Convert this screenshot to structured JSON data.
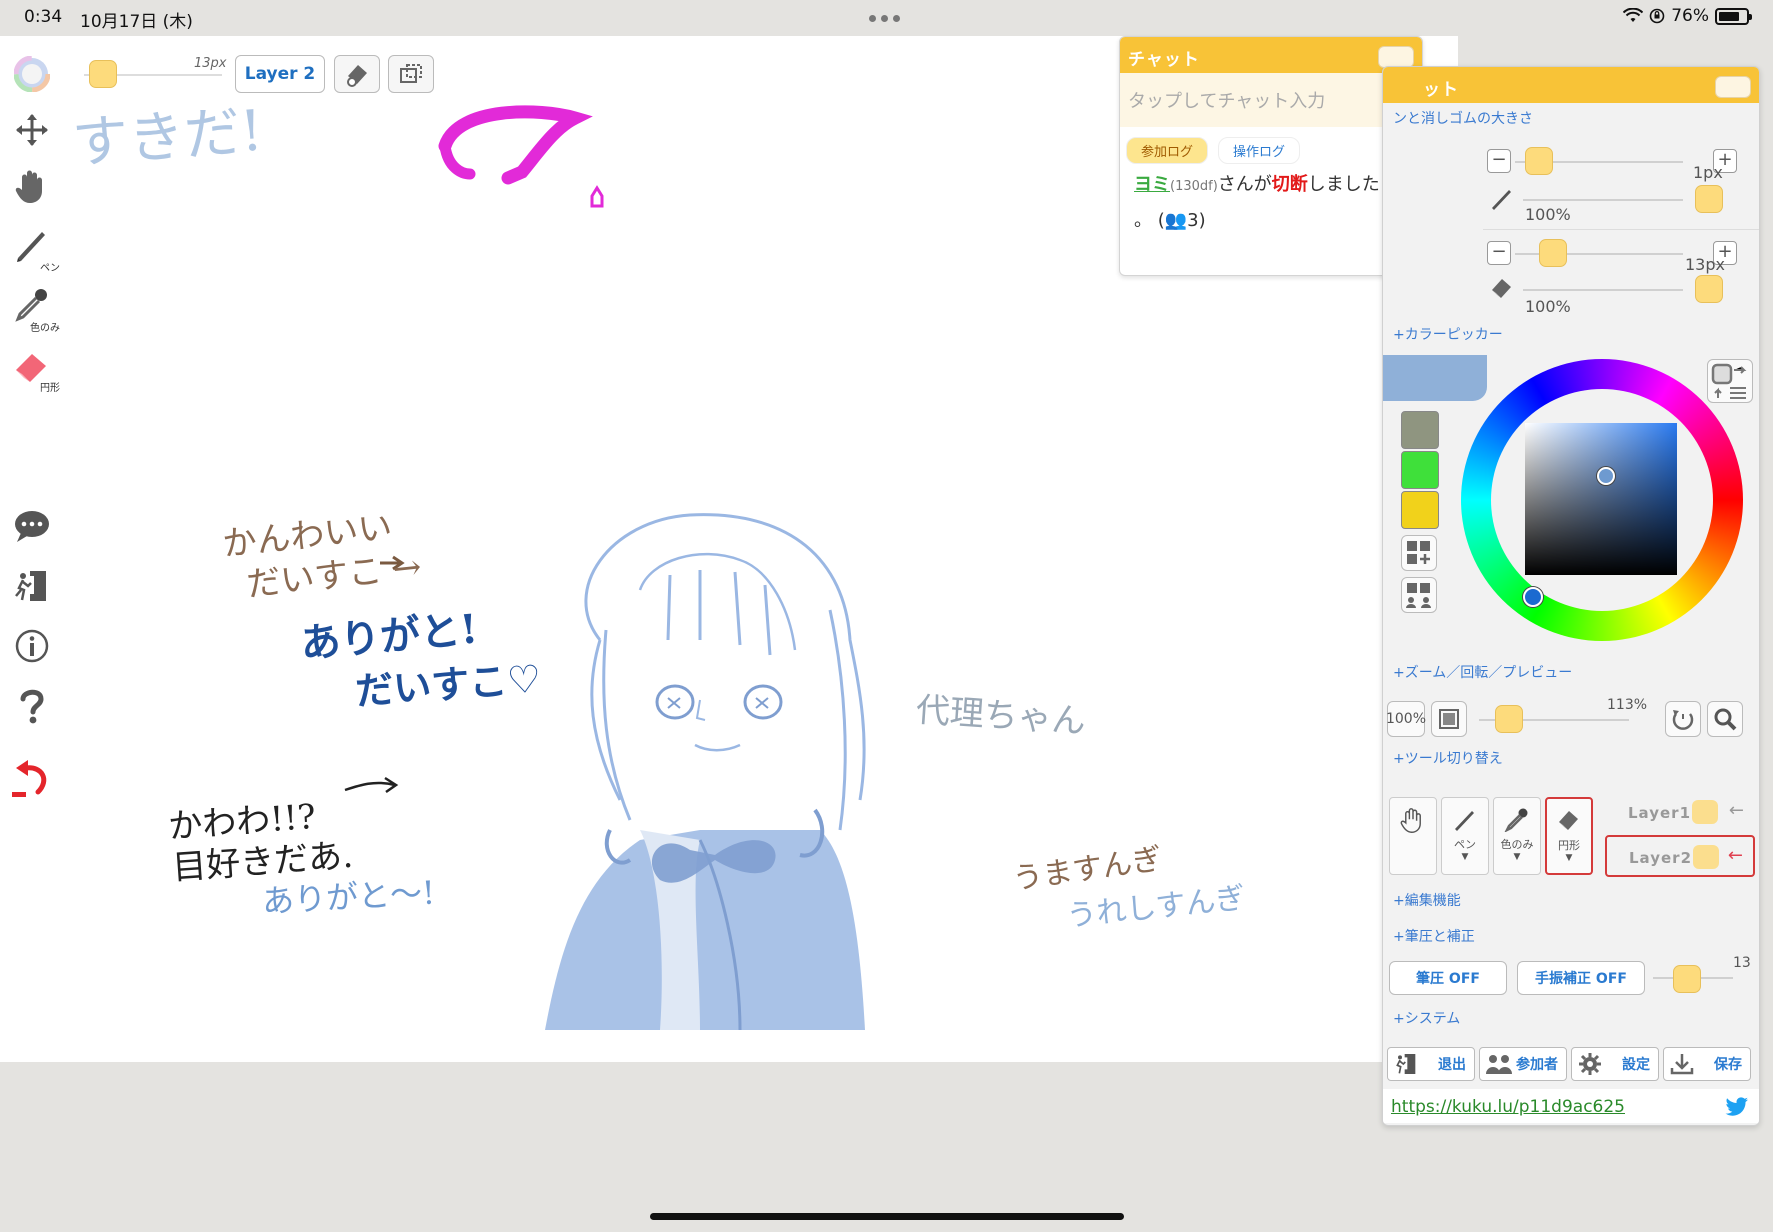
{
  "status_bar": {
    "time": "0:34",
    "date": "10月17日 (木)",
    "battery": "76%"
  },
  "canvas_toolbar": {
    "size": "13px",
    "layer": "Layer 2"
  },
  "left_toolbar": {
    "pen_label": "ペン",
    "dropper_label": "色のみ",
    "eraser_label": "円形"
  },
  "canvas_text": {
    "t1": "すきだ!",
    "t2": "かんわいい",
    "t3": "だいすこ →",
    "t4": "ありがと!",
    "t5": "だいすこ♡",
    "t6": "かわわ!!?",
    "t7": "目好きだあ.",
    "t8": "ありがと〜!",
    "t9": "代理ちゃん",
    "t10": "うますんぎ",
    "t11": "うれしすんぎ"
  },
  "chat": {
    "title": "チャット",
    "placeholder": "タップしてチャット入力",
    "tab_join": "参加ログ",
    "tab_ops": "操作ログ",
    "user": "ヨミ",
    "user_id": "(130df)",
    "msg_mid": "さんが",
    "msg_cut": "切断",
    "msg_end": "しました",
    "msg_line2": "。 (👥3)"
  },
  "panel": {
    "title": "ット",
    "sec_size": "ンと消しゴムの大きさ",
    "pen_size": "1px",
    "pen_opacity": "100%",
    "eraser_size": "13px",
    "eraser_opacity": "100%",
    "sec_color": "+カラーピッカー",
    "swatches": [
      "#8f9580",
      "#3fe03a",
      "#f1d21b"
    ],
    "current_color": "#8fb0d8",
    "sec_zoom": "+ズーム／回転／プレビュー",
    "zoom_reset": "100%",
    "zoom": "113%",
    "sec_tools": "+ツール切り替え",
    "tool_pen": "ペン",
    "tool_dropper": "色のみ",
    "tool_eraser": "円形",
    "layer1": "Layer1",
    "layer2": "Layer2",
    "sec_edit": "+編集機能",
    "sec_pressure": "+筆圧と補正",
    "btn_pressure": "筆圧 OFF",
    "btn_stabilizer": "手振補正 OFF",
    "stabilizer_value": "13",
    "sec_system": "+システム",
    "btn_exit": "退出",
    "btn_members": "参加者",
    "btn_settings": "設定",
    "btn_save": "保存",
    "url": "https://kuku.lu/p11d9ac625"
  }
}
